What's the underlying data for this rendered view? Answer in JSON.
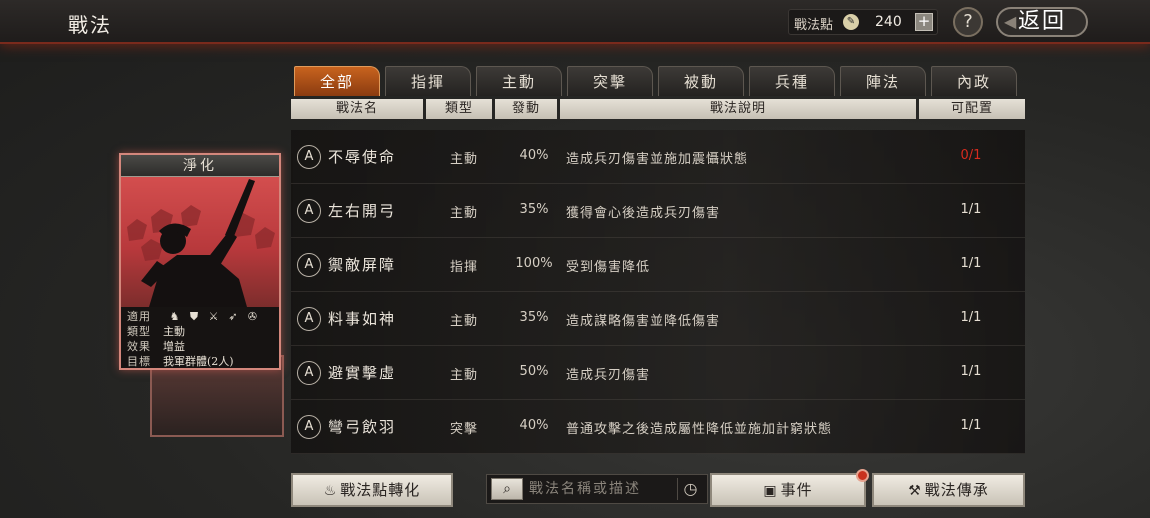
{
  "header": {
    "title": "戰法",
    "points_label": "戰法點",
    "points_value": "240",
    "help_label": "?",
    "back_label": "返回"
  },
  "tabs": [
    "全部",
    "指揮",
    "主動",
    "突擊",
    "被動",
    "兵種",
    "陣法",
    "內政"
  ],
  "active_tab": "全部",
  "table": {
    "columns": [
      "戰法名",
      "類型",
      "發動",
      "戰法說明",
      "可配置"
    ],
    "rows": [
      {
        "grade": "A",
        "name": "不辱使命",
        "type": "主動",
        "rate": "40%",
        "desc": "造成兵刃傷害並施加震懾狀態",
        "config": "0/1"
      },
      {
        "grade": "A",
        "name": "左右開弓",
        "type": "主動",
        "rate": "35%",
        "desc": "獲得會心後造成兵刃傷害",
        "config": "1/1"
      },
      {
        "grade": "A",
        "name": "禦敵屏障",
        "type": "指揮",
        "rate": "100%",
        "desc": "受到傷害降低",
        "config": "1/1"
      },
      {
        "grade": "A",
        "name": "料事如神",
        "type": "主動",
        "rate": "35%",
        "desc": "造成謀略傷害並降低傷害",
        "config": "1/1"
      },
      {
        "grade": "A",
        "name": "避實擊虛",
        "type": "主動",
        "rate": "50%",
        "desc": "造成兵刃傷害",
        "config": "1/1"
      },
      {
        "grade": "A",
        "name": "彎弓飲羽",
        "type": "突擊",
        "rate": "40%",
        "desc": "普通攻擊之後造成屬性降低並施加計窮狀態",
        "config": "1/1"
      }
    ]
  },
  "card": {
    "title": "淨化",
    "applicable_label": "適用",
    "unit_icons": [
      "cavalry-icon",
      "shield-icon",
      "crossed-swords-icon",
      "spear-icon",
      "wheel-icon"
    ],
    "type_label": "類型",
    "type_value": "主動",
    "effect_label": "效果",
    "effect_value": "增益",
    "target_label": "目標",
    "target_value": "我軍群體(2人)"
  },
  "buttons": {
    "convert_label": "戰法點轉化",
    "search_placeholder": "戰法名稱或描述",
    "event_label": "事件",
    "inherit_label": "戰法傳承"
  },
  "colors": {
    "accent": "#c8631e",
    "alert": "#d62b1e",
    "card_red": "#c0393c"
  }
}
